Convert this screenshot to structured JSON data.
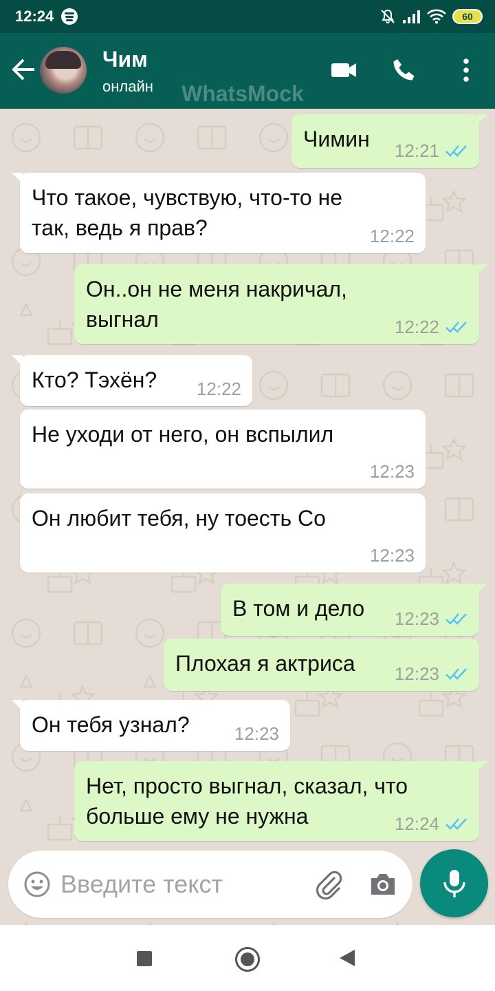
{
  "status_bar": {
    "time": "12:24",
    "battery": "60",
    "icons": [
      "spotify-icon",
      "silent-bell-icon",
      "signal-icon",
      "wifi-icon",
      "battery-icon"
    ]
  },
  "header": {
    "contact_name": "Чим",
    "contact_status": "онлайн",
    "watermark": "WhatsMock",
    "icons": [
      "back-arrow-icon",
      "video-call-icon",
      "voice-call-icon",
      "more-options-icon"
    ]
  },
  "colors": {
    "status_bar": "#054d44",
    "header": "#075e54",
    "chat_background": "#e5ddd5",
    "outgoing_bubble": "#dcf8c6",
    "incoming_bubble": "#ffffff",
    "read_ticks": "#4fc3f7",
    "mic_button": "#0a8a7d"
  },
  "messages": [
    {
      "direction": "out",
      "lines": [
        "Чимин"
      ],
      "time": "12:21",
      "read": true
    },
    {
      "direction": "in",
      "lines": [
        "Что такое, чувствую, что-то не",
        "так, ведь я прав?"
      ],
      "time": "12:22"
    },
    {
      "direction": "out",
      "lines": [
        "Он..он не меня накричал,",
        "выгнал"
      ],
      "time": "12:22",
      "read": true
    },
    {
      "direction": "in",
      "lines": [
        "Кто? Тэхён?"
      ],
      "time": "12:22"
    },
    {
      "direction": "in",
      "lines": [
        "Не уходи от него, он вспылил"
      ],
      "time": "12:23"
    },
    {
      "direction": "in",
      "lines": [
        "Он любит тебя, ну тоесть Со"
      ],
      "time": "12:23"
    },
    {
      "direction": "out",
      "lines": [
        "В том и дело"
      ],
      "time": "12:23",
      "read": true
    },
    {
      "direction": "out",
      "lines": [
        "Плохая я актриса"
      ],
      "time": "12:23",
      "read": true
    },
    {
      "direction": "in",
      "lines": [
        "Он тебя узнал?"
      ],
      "time": "12:23"
    },
    {
      "direction": "out",
      "lines": [
        "Нет, просто выгнал, сказал, что",
        "больше ему не нужна"
      ],
      "time": "12:24",
      "read": true
    }
  ],
  "composer": {
    "placeholder": "Введите текст",
    "value": "",
    "icons": [
      "emoji-icon",
      "attach-icon",
      "camera-icon",
      "mic-icon"
    ]
  },
  "nav_bar": {
    "icons": [
      "recents-icon",
      "home-icon",
      "back-icon"
    ]
  }
}
